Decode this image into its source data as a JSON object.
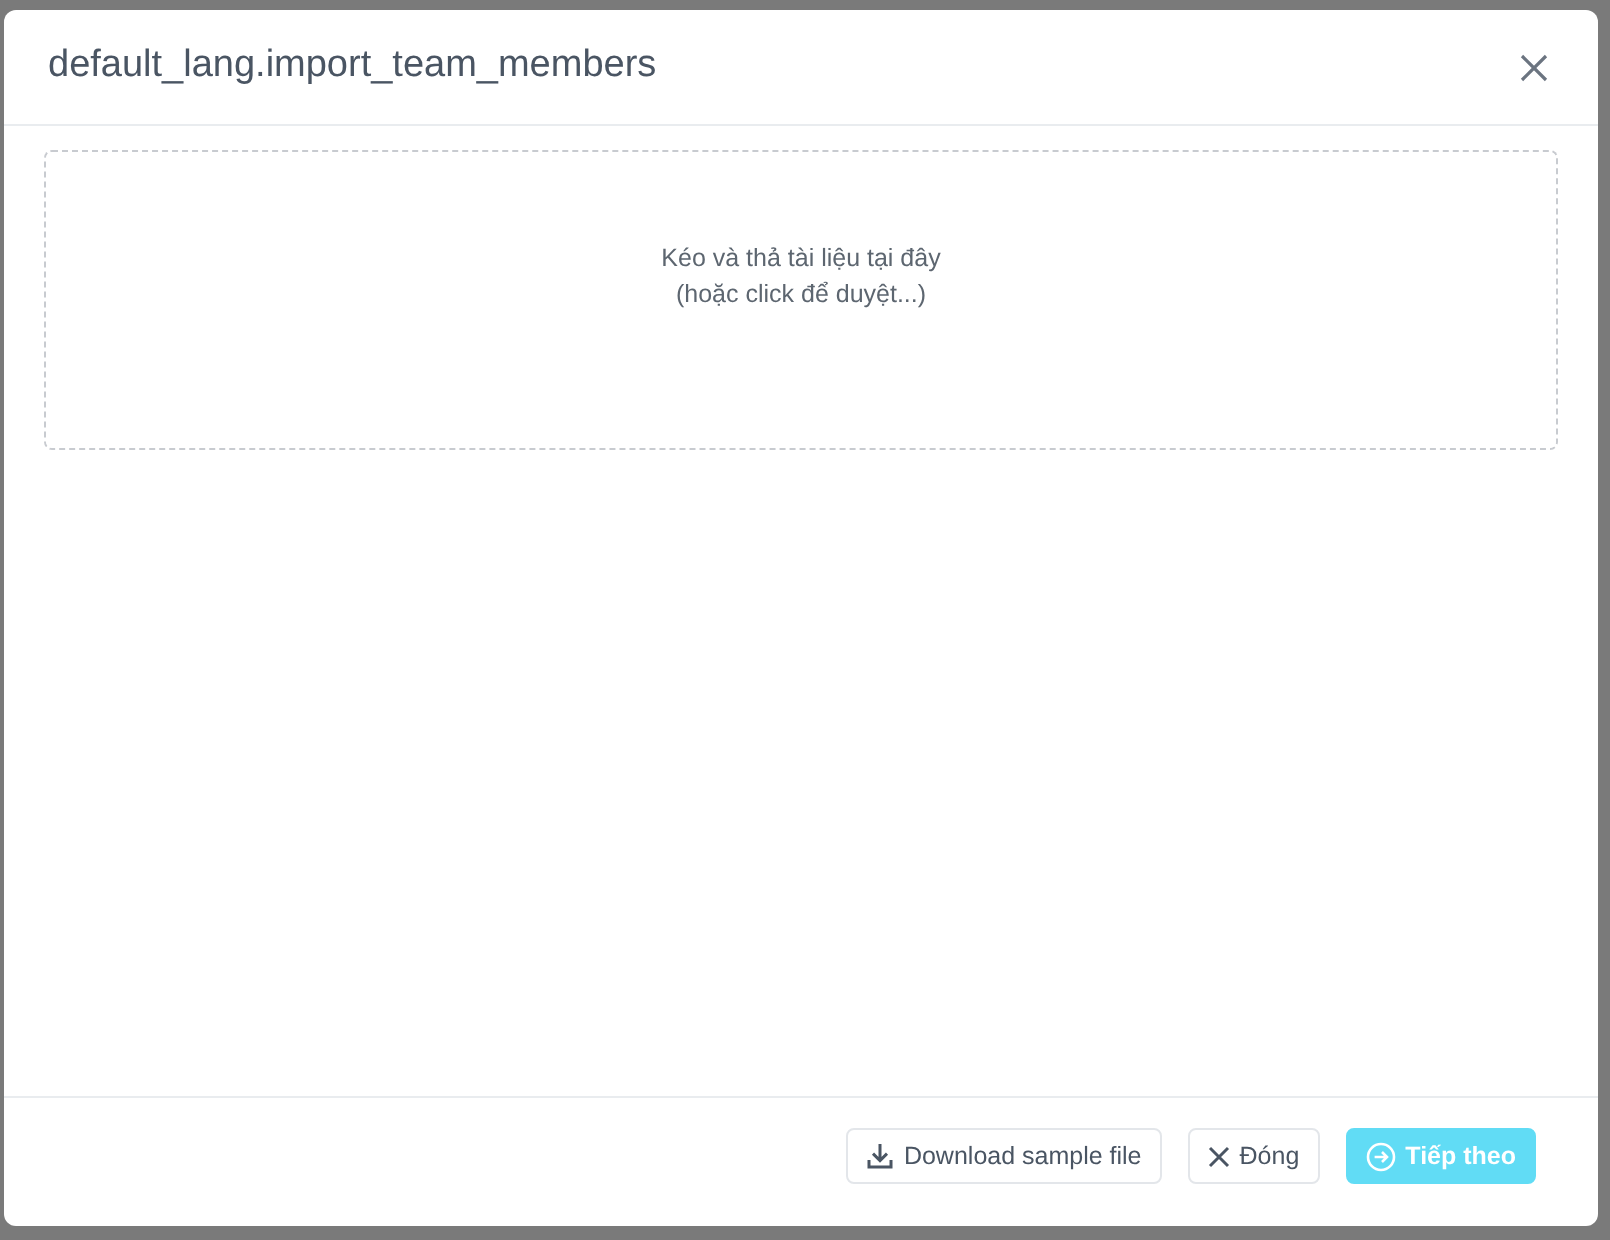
{
  "modal": {
    "title": "default_lang.import_team_members"
  },
  "dropzone": {
    "lines": [
      "Kéo và thả tài liệu tại đây",
      "(hoặc click để duyệt...)"
    ]
  },
  "footer": {
    "buttons": [
      {
        "kind": "download",
        "label": "Download sample file",
        "disabled": false
      },
      {
        "kind": "close",
        "label": "Đóng",
        "disabled": false
      },
      {
        "kind": "next",
        "label": "Tiếp theo",
        "disabled": true
      }
    ]
  }
}
